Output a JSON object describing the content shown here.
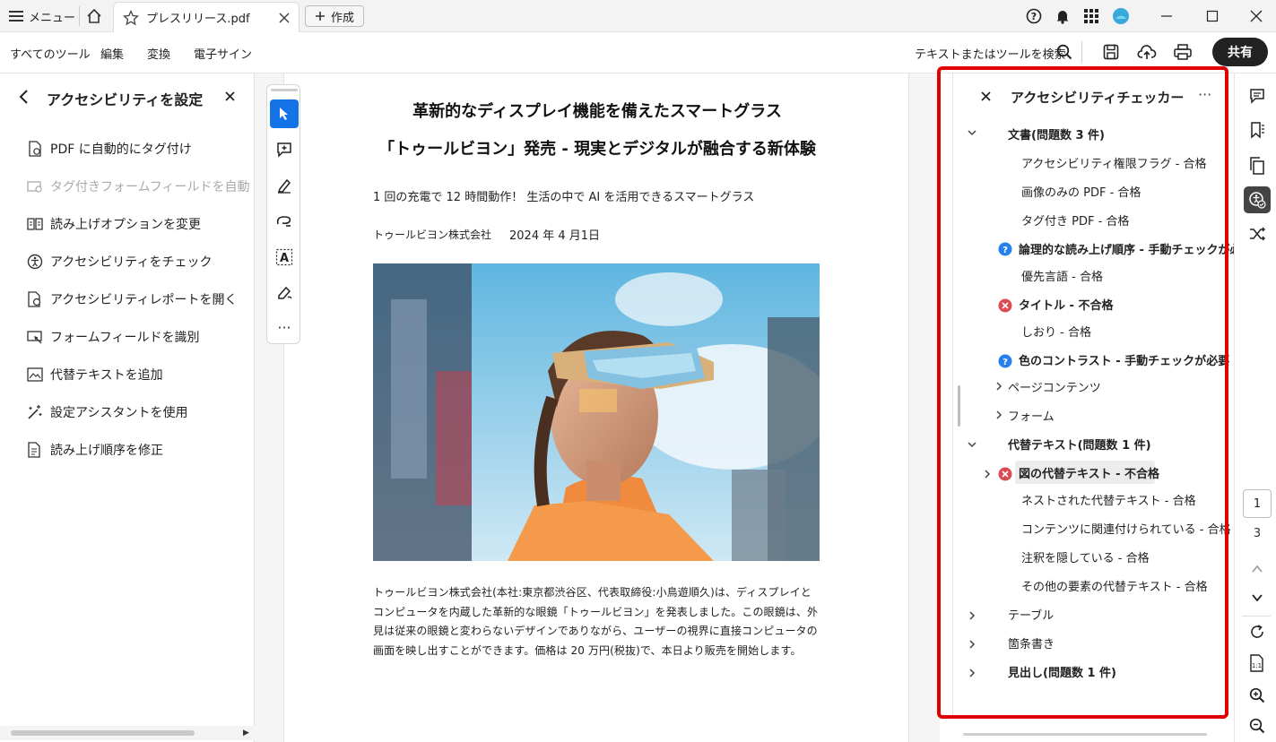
{
  "titlebar": {
    "menu_label": "メニュー",
    "tab_title": "プレスリリース.pdf",
    "create_label": "作成"
  },
  "menubar": {
    "items": [
      "すべてのツール",
      "編集",
      "変換",
      "電子サイン"
    ],
    "search_label": "テキストまたはツールを検索",
    "share_label": "共有"
  },
  "left_panel": {
    "title": "アクセシビリティを設定",
    "items": [
      {
        "label": "PDF に自動的にタグ付け",
        "icon": "auto-tag-icon"
      },
      {
        "label": "タグ付きフォームフィールドを自動",
        "icon": "form-tag-icon",
        "disabled": true
      },
      {
        "label": "読み上げオプションを変更",
        "icon": "read-aloud-icon"
      },
      {
        "label": "アクセシビリティをチェック",
        "icon": "accessibility-check-icon"
      },
      {
        "label": "アクセシビリティレポートを開く",
        "icon": "report-icon"
      },
      {
        "label": "フォームフィールドを識別",
        "icon": "form-identify-icon"
      },
      {
        "label": "代替テキストを追加",
        "icon": "alt-text-icon"
      },
      {
        "label": "設定アシスタントを使用",
        "icon": "assistant-icon"
      },
      {
        "label": "読み上げ順序を修正",
        "icon": "reading-order-icon"
      }
    ]
  },
  "document": {
    "headline1": "革新的なディスプレイ機能を備えたスマートグラス",
    "headline2": "「トゥールビヨン」発売 - 現実とデジタルが融合する新体験",
    "subtitle": "1 回の充電で 12 時間動作！ 生活の中で AI を活用できるスマートグラス",
    "company": "トゥールビヨン株式会社",
    "date": "2024 年 4 月1日",
    "body": "トゥールビヨン株式会社(本社:東京都渋谷区、代表取締役:小鳥遊順久)は、ディスプレイとコンピュータを内蔵した革新的な眼鏡「トゥールビヨン」を発表しました。この眼鏡は、外見は従来の眼鏡と変わらないデザインでありながら、ユーザーの視界に直接コンピュータの画面を映し出すことができます。価格は 20 万円(税抜)で、本日より販売を開始します。"
  },
  "checker": {
    "title": "アクセシビリティチェッカー",
    "rows": [
      {
        "label": "文書(問題数 3 件)",
        "type": "section-open",
        "bold": true
      },
      {
        "label": "アクセシビリティ権限フラグ - 合格",
        "type": "item"
      },
      {
        "label": "画像のみの PDF - 合格",
        "type": "item"
      },
      {
        "label": "タグ付き PDF - 合格",
        "type": "item"
      },
      {
        "label": "論理的な読み上げ順序 - 手動チェックが必",
        "type": "warn",
        "bold": true
      },
      {
        "label": "優先言語 - 合格",
        "type": "item"
      },
      {
        "label": "タイトル - 不合格",
        "type": "fail",
        "bold": true
      },
      {
        "label": "しおり - 合格",
        "type": "item"
      },
      {
        "label": "色のコントラスト - 手動チェックが必要",
        "type": "warn",
        "bold": true
      },
      {
        "label": "ページコンテンツ",
        "type": "section-closed"
      },
      {
        "label": "フォーム",
        "type": "section-closed"
      },
      {
        "label": "代替テキスト(問題数 1 件)",
        "type": "section-open",
        "bold": true
      },
      {
        "label": "図の代替テキスト - 不合格",
        "type": "fail-selected",
        "bold": true
      },
      {
        "label": "ネストされた代替テキスト - 合格",
        "type": "item"
      },
      {
        "label": "コンテンツに関連付けられている - 合格",
        "type": "item"
      },
      {
        "label": "注釈を隠している - 合格",
        "type": "item"
      },
      {
        "label": "その他の要素の代替テキスト - 合格",
        "type": "item"
      },
      {
        "label": "テーブル",
        "type": "section-closed"
      },
      {
        "label": "箇条書き",
        "type": "section-closed"
      },
      {
        "label": "見出し(問題数 1 件)",
        "type": "section-closed",
        "bold": true
      }
    ]
  },
  "page_nav": {
    "current": "1",
    "total": "3"
  },
  "colors": {
    "accent": "#1473e6",
    "highlight_border": "#e00000",
    "fail": "#d7373f",
    "warn": "#2680eb"
  }
}
